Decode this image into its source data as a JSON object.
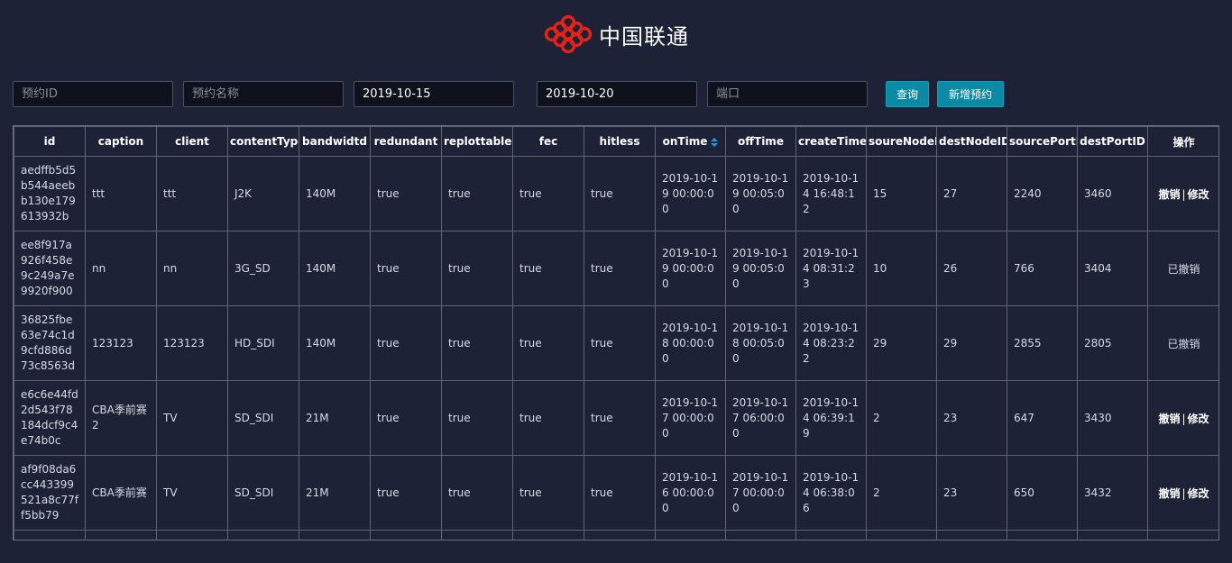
{
  "header": {
    "logo_text": "中国联通"
  },
  "filters": {
    "id_placeholder": "预约ID",
    "name_placeholder": "预约名称",
    "start_date": "2019-10-15",
    "end_date": "2019-10-20",
    "port_placeholder": "端口",
    "query_label": "查询",
    "add_label": "新增预约"
  },
  "table": {
    "columns": [
      "id",
      "caption",
      "client",
      "contentType",
      "bandwidtd",
      "redundant",
      "replottable",
      "fec",
      "hitless",
      "onTime",
      "offTime",
      "createTime",
      "soureNodeID",
      "destNodeID",
      "sourcePortID",
      "destPortID",
      "操作"
    ],
    "ops": {
      "cancel": "撤销",
      "separator": "|",
      "edit": "修改"
    },
    "rows": [
      {
        "id": "aedffb5d5b544aeebb130e179613932b",
        "caption": "ttt",
        "client": "ttt",
        "contentType": "J2K",
        "bandwidtd": "140M",
        "redundant": "true",
        "replottable": "true",
        "fec": "true",
        "hitless": "true",
        "onTime": "2019-10-19 00:00:00",
        "offTime": "2019-10-19 00:05:00",
        "createTime": "2019-10-14 16:48:12",
        "soureNodeID": "15",
        "destNodeID": "27",
        "sourcePortID": "2240",
        "destPortID": "3460",
        "status": ""
      },
      {
        "id": "ee8f917a926f458e9c249a7e9920f900",
        "caption": "nn",
        "client": "nn",
        "contentType": "3G_SD",
        "bandwidtd": "140M",
        "redundant": "true",
        "replottable": "true",
        "fec": "true",
        "hitless": "true",
        "onTime": "2019-10-19 00:00:00",
        "offTime": "2019-10-19 00:05:00",
        "createTime": "2019-10-14 08:31:23",
        "soureNodeID": "10",
        "destNodeID": "26",
        "sourcePortID": "766",
        "destPortID": "3404",
        "status": "已撤销"
      },
      {
        "id": "36825fbe63e74c1d9cfd886d73c8563d",
        "caption": "123123",
        "client": "123123",
        "contentType": "HD_SDI",
        "bandwidtd": "140M",
        "redundant": "true",
        "replottable": "true",
        "fec": "true",
        "hitless": "true",
        "onTime": "2019-10-18 00:00:00",
        "offTime": "2019-10-18 00:05:00",
        "createTime": "2019-10-14 08:23:22",
        "soureNodeID": "29",
        "destNodeID": "29",
        "sourcePortID": "2855",
        "destPortID": "2805",
        "status": "已撤销"
      },
      {
        "id": "e6c6e44fd2d543f78184dcf9c4e74b0c",
        "caption": "CBA季前赛2",
        "client": "TV",
        "contentType": "SD_SDI",
        "bandwidtd": "21M",
        "redundant": "true",
        "replottable": "true",
        "fec": "true",
        "hitless": "true",
        "onTime": "2019-10-17 00:00:00",
        "offTime": "2019-10-17 06:00:00",
        "createTime": "2019-10-14 06:39:19",
        "soureNodeID": "2",
        "destNodeID": "23",
        "sourcePortID": "647",
        "destPortID": "3430",
        "status": ""
      },
      {
        "id": "af9f08da6cc443399521a8c77ff5bb79",
        "caption": "CBA季前赛",
        "client": "TV",
        "contentType": "SD_SDI",
        "bandwidtd": "21M",
        "redundant": "true",
        "replottable": "true",
        "fec": "true",
        "hitless": "true",
        "onTime": "2019-10-16 00:00:00",
        "offTime": "2019-10-17 00:00:00",
        "createTime": "2019-10-14 06:38:06",
        "soureNodeID": "2",
        "destNodeID": "23",
        "sourcePortID": "650",
        "destPortID": "3432",
        "status": ""
      }
    ]
  },
  "colors": {
    "background": "#1d2236",
    "input_background": "#0f111c",
    "button": "#0b8aa5",
    "logo_red": "#e2231a",
    "sort_arrow": "#1e9be0"
  }
}
